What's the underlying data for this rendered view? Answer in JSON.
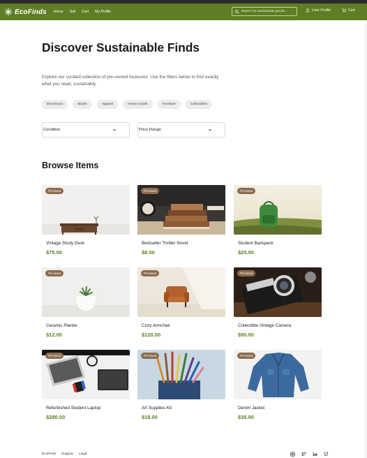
{
  "brand": {
    "name": "EcoFinds"
  },
  "nav": {
    "links": [
      "Home",
      "Sell",
      "Cart",
      "My Profile"
    ],
    "search_placeholder": "Search for sustainable goods...",
    "user_profile": "User Profile",
    "cart": "Cart"
  },
  "hero": {
    "title": "Discover Sustainable Finds",
    "description": "Explore our curated collection of pre-owned treasures. Use the filters below to find exactly what you need, sustainably."
  },
  "categories": [
    "Electronics",
    "Books",
    "Apparel",
    "Home Goods",
    "Furniture",
    "Collectibles"
  ],
  "filters": {
    "condition": "Condition",
    "price_range": "Price Range"
  },
  "browse": {
    "title": "Browse Items",
    "items": [
      {
        "badge": "Pre-loved",
        "name": "Vintage Study Desk",
        "price": "$75.00",
        "image": "desk"
      },
      {
        "badge": "Pre-loved",
        "name": "Bestseller Thriller Novel",
        "price": "$8.50",
        "image": "books"
      },
      {
        "badge": "Pre-loved",
        "name": "Student Backpack",
        "price": "$25.00",
        "image": "backpack"
      },
      {
        "badge": "Pre-loved",
        "name": "Ceramic Planter",
        "price": "$12.00",
        "image": "planter"
      },
      {
        "badge": "Pre-loved",
        "name": "Cozy Armchair",
        "price": "$120.00",
        "image": "armchair"
      },
      {
        "badge": "Pre-loved",
        "name": "Collectible Vintage Camera",
        "price": "$90.00",
        "image": "camera"
      },
      {
        "badge": "Pre-loved",
        "name": "Refurbished Student Laptop",
        "price": "$280.00",
        "image": "laptop"
      },
      {
        "badge": "Pre-loved",
        "name": "Art Supplies Kit",
        "price": "$18.00",
        "image": "art-supplies"
      },
      {
        "badge": "Pre-loved",
        "name": "Denim Jacket",
        "price": "$35.00",
        "image": "denim-jacket"
      }
    ]
  },
  "footer": {
    "links": [
      "EcoFinds",
      "Support",
      "Legal"
    ],
    "social_icons": [
      "instagram-icon",
      "twitter-icon",
      "linkedin-icon",
      "github-icon"
    ]
  },
  "colors": {
    "brand_green": "#5d7e25",
    "badge_brown": "#8c6c4f",
    "price_green": "#5d7e25"
  }
}
